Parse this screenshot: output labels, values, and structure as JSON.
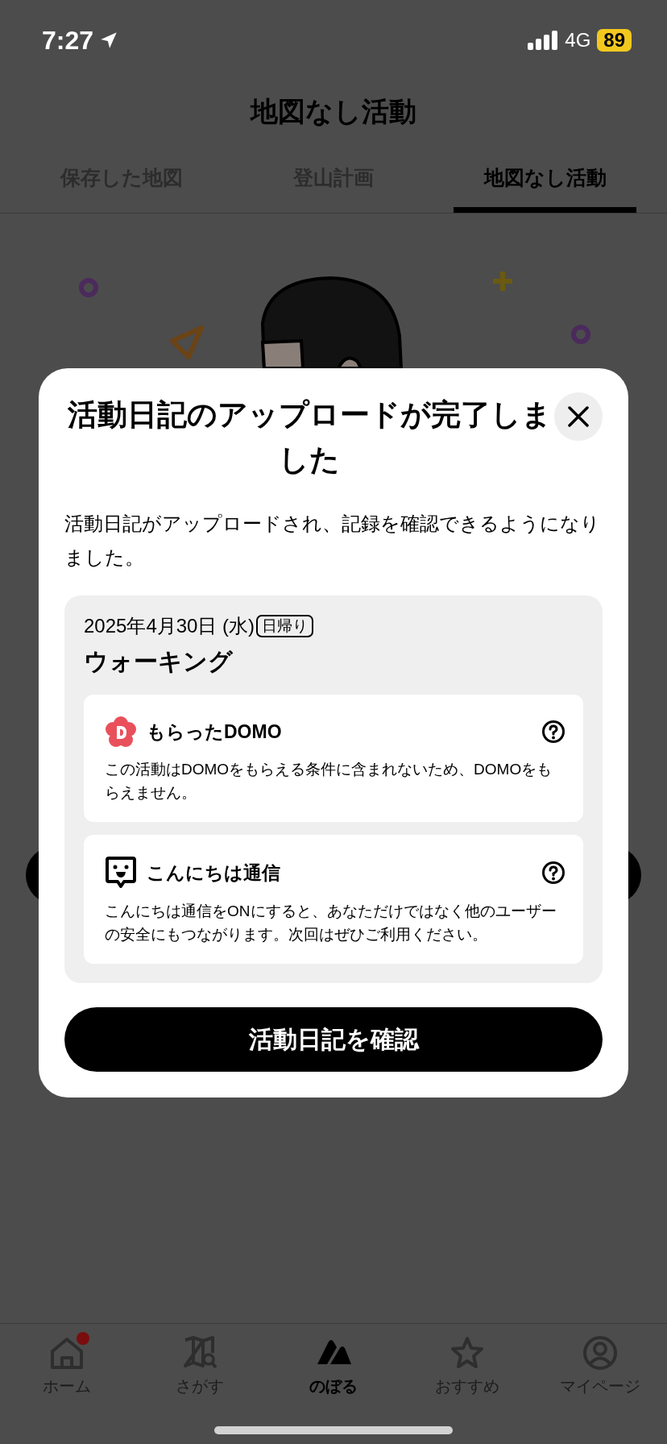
{
  "status_bar": {
    "time": "7:27",
    "network": "4G",
    "battery": "89"
  },
  "header": {
    "title": "地図なし活動"
  },
  "tabs": [
    {
      "label": "保存した地図",
      "selected": false
    },
    {
      "label": "登山計画",
      "selected": false
    },
    {
      "label": "地図なし活動",
      "selected": true
    }
  ],
  "dialog": {
    "title": "活動日記のアップロードが完了しました",
    "message": "活動日記がアップロードされ、記録を確認できるようになりました。",
    "activity": {
      "date": "2025年4月30日 (水)",
      "tag": "日帰り",
      "name": "ウォーキング"
    },
    "sections": [
      {
        "kind": "domo",
        "title": "もらったDOMO",
        "text": "この活動はDOMOをもらえる条件に含まれないため、DOMOをもらえません。"
      },
      {
        "kind": "greeting",
        "title": "こんにちは通信",
        "text": "こんにちは通信をONにすると、あなただけではなく他のユーザーの安全にもつながります。次回はぜひご利用ください。"
      }
    ],
    "button": "活動日記を確認"
  },
  "nav": [
    {
      "label": "ホーム",
      "kind": "home",
      "selected": false,
      "badge": true
    },
    {
      "label": "さがす",
      "kind": "search",
      "selected": false,
      "badge": false
    },
    {
      "label": "のぼる",
      "kind": "climb",
      "selected": true,
      "badge": false
    },
    {
      "label": "おすすめ",
      "kind": "recommend",
      "selected": false,
      "badge": false
    },
    {
      "label": "マイページ",
      "kind": "mypage",
      "selected": false,
      "badge": false
    }
  ]
}
